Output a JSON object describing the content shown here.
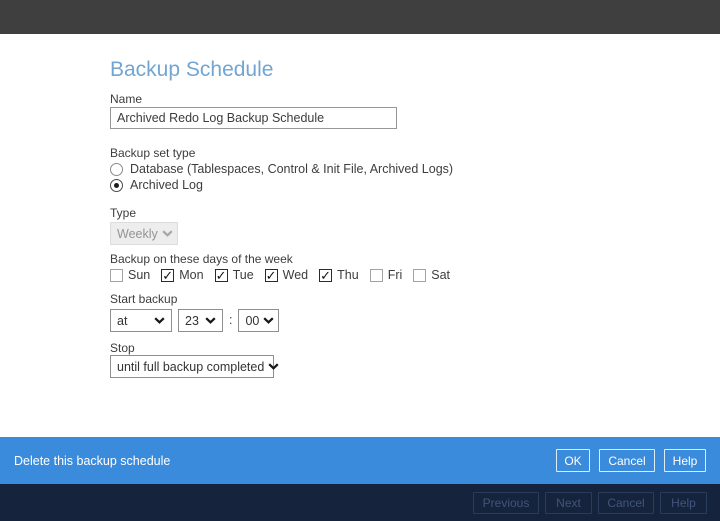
{
  "panel": {
    "title": "Backup Schedule",
    "name": {
      "label": "Name",
      "value": "Archived Redo Log Backup Schedule"
    },
    "backup_set_type": {
      "label": "Backup set type",
      "options": [
        {
          "label": "Database (Tablespaces, Control & Init File, Archived Logs)",
          "selected": false
        },
        {
          "label": "Archived Log",
          "selected": true
        }
      ]
    },
    "type": {
      "label": "Type",
      "value": "Weekly",
      "disabled": true
    },
    "days": {
      "label": "Backup on these days of the week",
      "items": [
        {
          "label": "Sun",
          "checked": false
        },
        {
          "label": "Mon",
          "checked": true
        },
        {
          "label": "Tue",
          "checked": true
        },
        {
          "label": "Wed",
          "checked": true
        },
        {
          "label": "Thu",
          "checked": true
        },
        {
          "label": "Fri",
          "checked": false
        },
        {
          "label": "Sat",
          "checked": false
        }
      ]
    },
    "start_backup": {
      "label": "Start backup",
      "mode_value": "at",
      "hour_value": "23",
      "separator": ":",
      "minute_value": "00"
    },
    "stop": {
      "label": "Stop",
      "value": "until full backup completed"
    }
  },
  "action_bar": {
    "delete_label": "Delete this backup schedule",
    "ok_label": "OK",
    "cancel_label": "Cancel",
    "help_label": "Help"
  },
  "wizard_bar": {
    "previous_label": "Previous",
    "next_label": "Next",
    "cancel_label": "Cancel",
    "help_label": "Help"
  },
  "colors": {
    "topbar_bg": "#3f3f3f",
    "title_text": "#72a5d1",
    "action_bar_bg": "#3a8bdb",
    "wizard_bar_bg": "#15233c",
    "button_border_light": "#ddeefb",
    "disabled_button_text": "#42547c"
  }
}
